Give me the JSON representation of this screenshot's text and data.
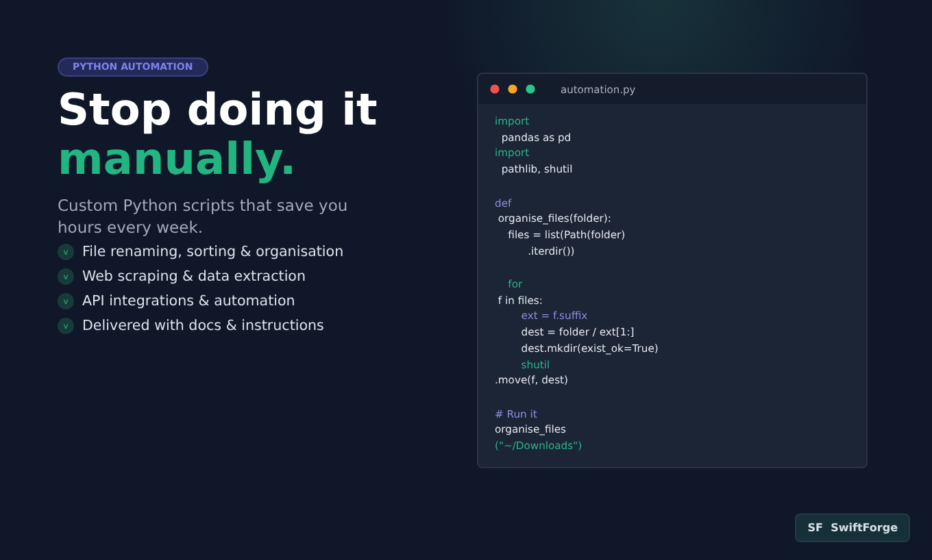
{
  "badge": "PYTHON AUTOMATION",
  "headline": {
    "line_1": "Stop doing it",
    "line_2": "manually."
  },
  "subtitle": "Custom Python scripts that save you hours every week.",
  "features": [
    {
      "check": "v",
      "text": "File renaming, sorting & organisation"
    },
    {
      "check": "v",
      "text": "Web scraping & data extraction"
    },
    {
      "check": "v",
      "text": "API integrations & automation"
    },
    {
      "check": "v",
      "text": "Delivered with docs & instructions"
    }
  ],
  "editor": {
    "filename": "automation.py",
    "lines": [
      {
        "kind": "keyword",
        "text": "import",
        "spaced": false
      },
      {
        "kind": "plain",
        "text": "  pandas as pd",
        "spaced": false
      },
      {
        "kind": "keyword",
        "text": "import",
        "spaced": false
      },
      {
        "kind": "plain",
        "text": "  pathlib, shutil",
        "spaced": false
      },
      {
        "kind": "def",
        "text": "def",
        "spaced": true
      },
      {
        "kind": "plain",
        "text": " organise_files(folder):",
        "spaced": false
      },
      {
        "kind": "plain",
        "text": "    files = list(Path(folder)",
        "spaced": false
      },
      {
        "kind": "plain",
        "text": "          .iterdir())",
        "spaced": false
      },
      {
        "kind": "keyword",
        "text": "    for",
        "spaced": true
      },
      {
        "kind": "plain",
        "text": " f in files:",
        "spaced": false
      },
      {
        "kind": "def",
        "text": "        ext = f.suffix",
        "spaced": false
      },
      {
        "kind": "plain",
        "text": "        dest = folder / ext[1:]",
        "spaced": false
      },
      {
        "kind": "plain",
        "text": "        dest.mkdir(exist_ok=True)",
        "spaced": false
      },
      {
        "kind": "keyword",
        "text": "        shutil",
        "spaced": false
      },
      {
        "kind": "plain",
        "text": ".move(f, dest)",
        "spaced": false
      },
      {
        "kind": "def",
        "text": "# Run it",
        "spaced": true
      },
      {
        "kind": "plain",
        "text": "organise_files",
        "spaced": false
      },
      {
        "kind": "keyword",
        "text": "(\"~/Downloads\")",
        "spaced": false
      }
    ]
  },
  "brand": "SF  SwiftForge"
}
